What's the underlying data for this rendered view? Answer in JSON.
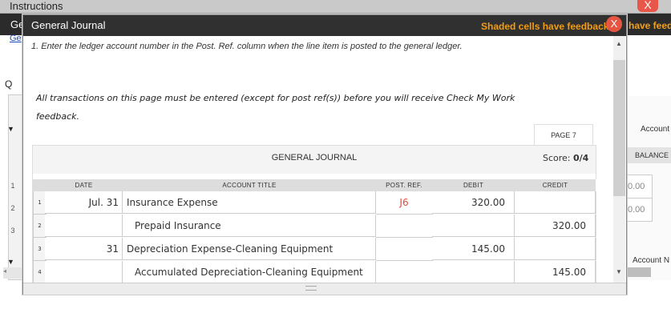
{
  "background": {
    "window_title": "Instructions",
    "close_glyph": "X",
    "header_label": "Ge",
    "link_text": "Ge",
    "feedback_text": "have feedb",
    "question_label": "Q",
    "row_numbers": [
      "1",
      "2",
      "3"
    ],
    "right_panel": {
      "account_top": "Account",
      "balance_header": "BALANCE",
      "balance_values": [
        "0.00",
        "0.00"
      ],
      "account_bottom": "Account N"
    }
  },
  "modal": {
    "title": "General Journal",
    "feedback_text": "Shaded cells have feedback.",
    "close_glyph": "X",
    "instruction1": "1. Enter the ledger account number in the Post. Ref. column when the line item is posted to the general ledger.",
    "instruction2": "All transactions on this page must be entered (except for post ref(s)) before you will receive Check My Work feedback.",
    "page_tab": "PAGE 7",
    "journal": {
      "title": "GENERAL JOURNAL",
      "score_label": "Score:",
      "score_value": "0/4",
      "columns": [
        "DATE",
        "ACCOUNT TITLE",
        "POST. REF.",
        "DEBIT",
        "CREDIT"
      ],
      "rows": [
        {
          "num": "1",
          "date": "Jul. 31",
          "account": "Insurance Expense",
          "post_ref": "J6",
          "debit": "320.00",
          "credit": ""
        },
        {
          "num": "2",
          "date": "",
          "account": "Prepaid Insurance",
          "post_ref": "",
          "debit": "",
          "credit": "320.00"
        },
        {
          "num": "3",
          "date": "31",
          "account": "Depreciation Expense-Cleaning Equipment",
          "post_ref": "",
          "debit": "145.00",
          "credit": ""
        },
        {
          "num": "4",
          "date": "",
          "account": "Accumulated Depreciation-Cleaning Equipment",
          "post_ref": "",
          "debit": "",
          "credit": "145.00"
        }
      ]
    }
  },
  "colors": {
    "titlebar": "#303030",
    "feedback": "#f39c12",
    "close": "#e55542",
    "post_ref": "#e74c3c"
  }
}
